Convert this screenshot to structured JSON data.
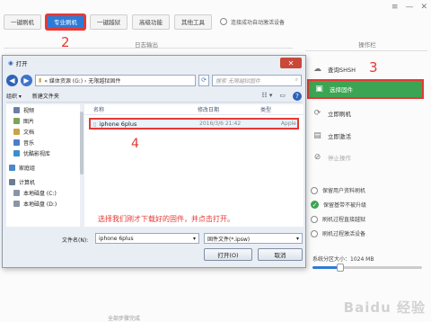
{
  "app": {
    "window_controls": [
      "≡",
      "—",
      "✕"
    ],
    "toolbar": [
      {
        "label": "一键刷机",
        "active": false
      },
      {
        "label": "专业刷机",
        "active": true
      },
      {
        "label": "一键越狱",
        "active": false
      },
      {
        "label": "高级功能",
        "active": false
      },
      {
        "label": "其他工具",
        "active": false
      }
    ],
    "auto_flash_label": "连接成功自动激活设备",
    "log_label": "日志输出",
    "right_title": "操作栏",
    "right_buttons": [
      {
        "label": "查询SHSH",
        "icon": "cloud-icon"
      },
      {
        "label": "选择固件",
        "icon": "folder-icon"
      },
      {
        "label": "立即刷机",
        "icon": "refresh-icon"
      },
      {
        "label": "立即激活",
        "icon": "activate-icon"
      },
      {
        "label": "停止操作",
        "icon": "stop-icon"
      }
    ],
    "options": [
      {
        "label": "保留用户资料刷机",
        "checked": false
      },
      {
        "label": "保留基带不被升级",
        "checked": true
      },
      {
        "label": "刷机过程直接越狱",
        "checked": false
      },
      {
        "label": "刷机过程激活设备",
        "checked": false
      }
    ],
    "cache_label": "系统分区大小：1024 MB",
    "cache_fraction": 0.25,
    "bottom_text": "全部步骤完成"
  },
  "annotations": {
    "n2": "2",
    "n3": "3",
    "n4": "4",
    "hint": "选择我们刚才下载好的固件，并点击打开。"
  },
  "dialog": {
    "title": "打开",
    "close": "✕",
    "path": "« 媒体资源 (G:) › 无限越狱固件",
    "search_placeholder": "搜索 无限越狱固件",
    "organize": "组织 ▾",
    "new_folder": "新建文件夹",
    "nav_items": [
      {
        "label": "视频",
        "group": false,
        "color": "#6a7fa8"
      },
      {
        "label": "图片",
        "group": false,
        "color": "#7fa25a"
      },
      {
        "label": "文档",
        "group": false,
        "color": "#c9a24a"
      },
      {
        "label": "音乐",
        "group": false,
        "color": "#4a7ec9"
      },
      {
        "label": "优酷影视库",
        "group": false,
        "color": "#3a8fd0"
      },
      {
        "label": "家庭组",
        "group": true,
        "color": "#4a88c9"
      },
      {
        "label": "计算机",
        "group": true,
        "color": "#6b7d93"
      },
      {
        "label": "本地磁盘 (C:)",
        "group": false,
        "color": "#8a96a6"
      },
      {
        "label": "本地磁盘 (D:)",
        "group": false,
        "color": "#8a96a6"
      }
    ],
    "columns": [
      "名称",
      "修改日期",
      "类型"
    ],
    "file": {
      "name": "iphone 6plus",
      "date": "2016/3/6 21:42",
      "type": "Apple"
    },
    "filename_label": "文件名(N):",
    "filename_value": "iphone 6plus",
    "filetype_value": "固件文件(*.ipsw)",
    "open_label": "打开(O)",
    "cancel_label": "取消"
  },
  "watermark": "Baidu 经验"
}
